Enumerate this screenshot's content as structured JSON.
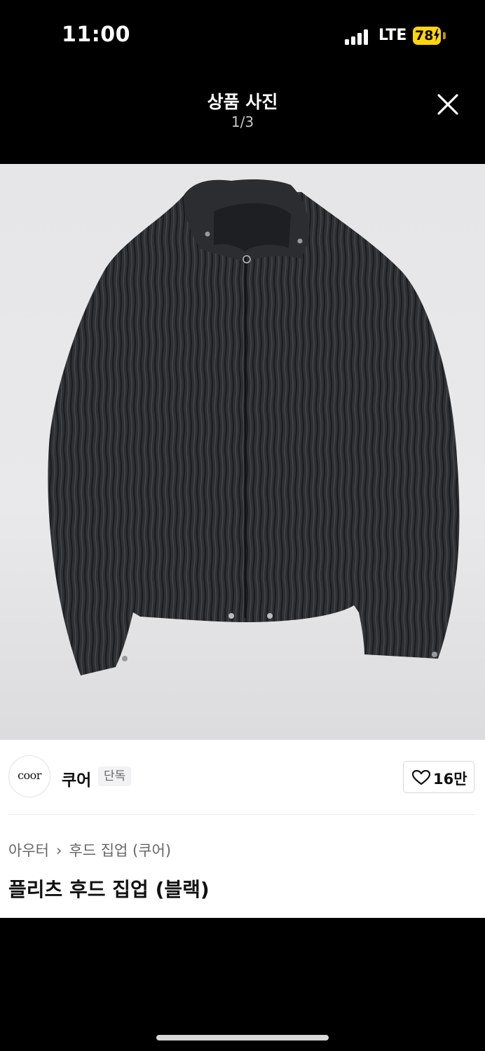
{
  "status_bar": {
    "time": "11:00",
    "network": "LTE",
    "battery": "78",
    "battery_color": "#ffd60a"
  },
  "header": {
    "title": "상품 사진",
    "counter": "1/3",
    "close_icon": "close-icon"
  },
  "photo": {
    "subject_icon": "jacket-image"
  },
  "brand": {
    "logo_text": "coor",
    "name": "쿠어",
    "badge": "단독"
  },
  "like": {
    "icon": "heart-icon",
    "count": "16만"
  },
  "breadcrumb": {
    "category": "아우터",
    "separator": "›",
    "subcategory": "후드 집업 (쿠어)"
  },
  "product": {
    "title": "플리츠 후드 집업 (블랙)"
  }
}
